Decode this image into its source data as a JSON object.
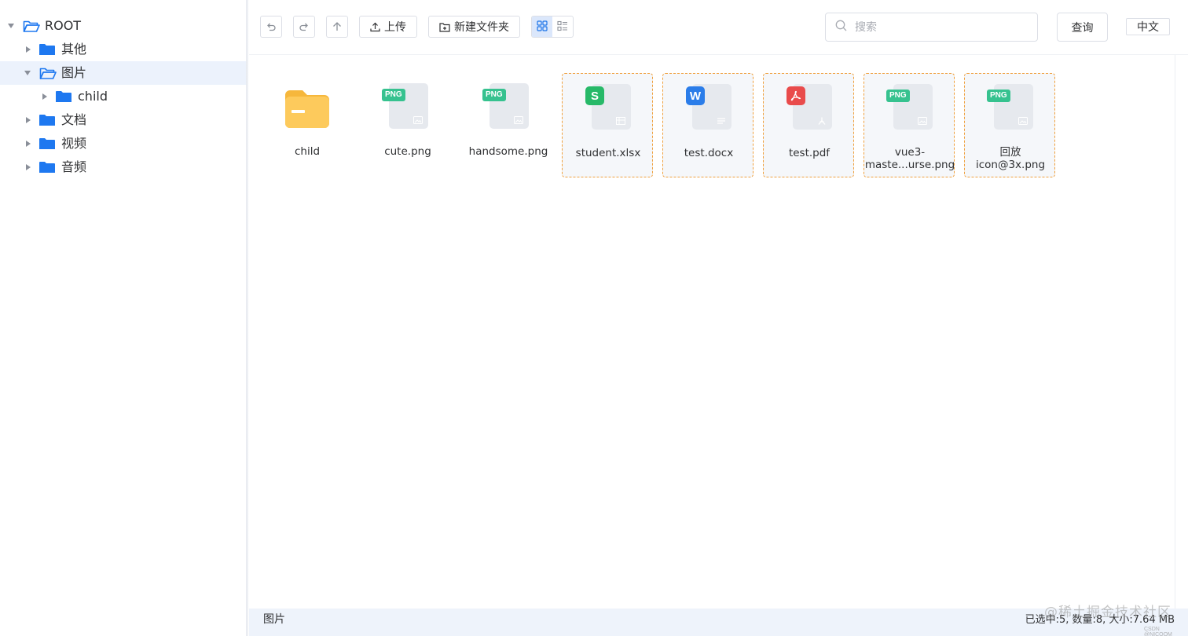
{
  "tree": {
    "root": "ROOT",
    "children": [
      {
        "label": "其他"
      },
      {
        "label": "图片",
        "children": [
          {
            "label": "child"
          }
        ]
      },
      {
        "label": "文档"
      },
      {
        "label": "视频"
      },
      {
        "label": "音频"
      }
    ]
  },
  "toolbar": {
    "undo_icon": "undo-icon",
    "redo_icon": "redo-icon",
    "up_icon": "arrow-up-icon",
    "upload_label": "上传",
    "new_folder_label": "新建文件夹",
    "view_modes": [
      "grid",
      "list"
    ],
    "active_view": "grid",
    "search_placeholder": "搜索",
    "search_value": "",
    "query_label": "查询",
    "language_label": "中文"
  },
  "files": [
    {
      "name": "child",
      "kind": "folder",
      "selected": false
    },
    {
      "name": "cute.png",
      "kind": "png",
      "badge": "PNG",
      "selected": false
    },
    {
      "name": "handsome.png",
      "kind": "png",
      "badge": "PNG",
      "selected": false
    },
    {
      "name": "student.xlsx",
      "kind": "xlsx",
      "badge": "S",
      "selected": true
    },
    {
      "name": "test.docx",
      "kind": "docx",
      "badge": "W",
      "selected": true
    },
    {
      "name": "test.pdf",
      "kind": "pdf",
      "badge": "",
      "selected": true
    },
    {
      "name_line1": "vue3-",
      "name_line2": "maste...urse.png",
      "kind": "png",
      "badge": "PNG",
      "selected": true
    },
    {
      "name_line1": "回放",
      "name_line2": "icon@3x.png",
      "kind": "png",
      "badge": "PNG",
      "selected": true
    }
  ],
  "status": {
    "path": "图片",
    "summary": "已选中:5, 数量:8, 大小:7.64 MB"
  },
  "watermark": "@稀土掘金技术社区",
  "watermark_small": "CSDN @NICOOM",
  "colors": {
    "accent": "#1a73e8",
    "folder_blue": "#1e78f0",
    "folder_yellow": "#fdca5c",
    "selection_border": "#f0a03c",
    "png_badge": "#36c28f",
    "xlsx": "#27b968",
    "docx": "#2b7de9",
    "pdf": "#e94b4b"
  }
}
